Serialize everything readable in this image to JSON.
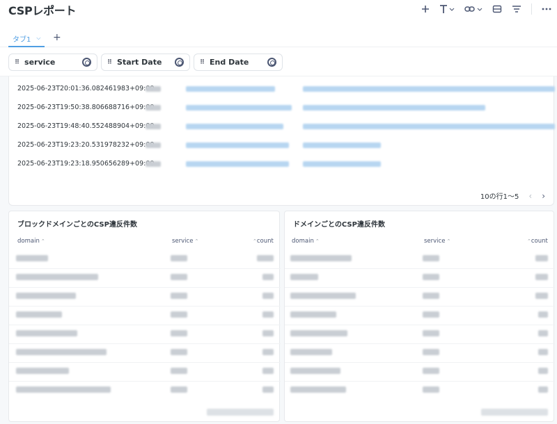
{
  "header": {
    "title": "CSPレポート"
  },
  "toolbar": {
    "icons": [
      "plus-icon",
      "text-icon",
      "link-icon",
      "card-icon",
      "filter-icon",
      "more-icon"
    ]
  },
  "tabs": [
    {
      "label": "タブ1"
    }
  ],
  "filters": [
    {
      "label": "service"
    },
    {
      "label": "Start Date"
    },
    {
      "label": "End Date"
    }
  ],
  "top_table": {
    "rows": [
      {
        "timestamp": "2025-06-23T20:01:36.082461983+09:00"
      },
      {
        "timestamp": "2025-06-23T19:50:38.806688716+09:00"
      },
      {
        "timestamp": "2025-06-23T19:48:40.552488904+09:00"
      },
      {
        "timestamp": "2025-06-23T19:23:20.531978232+09:00"
      },
      {
        "timestamp": "2025-06-23T19:23:18.950656289+09:00"
      }
    ],
    "pagination": "10の行1〜5"
  },
  "left_card": {
    "title": "ブロックドメインごとのCSP違反件数",
    "columns": [
      "domain",
      "service",
      "count"
    ]
  },
  "right_card": {
    "title": "ドメインごとのCSP違反件数",
    "columns": [
      "domain",
      "service",
      "count"
    ]
  }
}
